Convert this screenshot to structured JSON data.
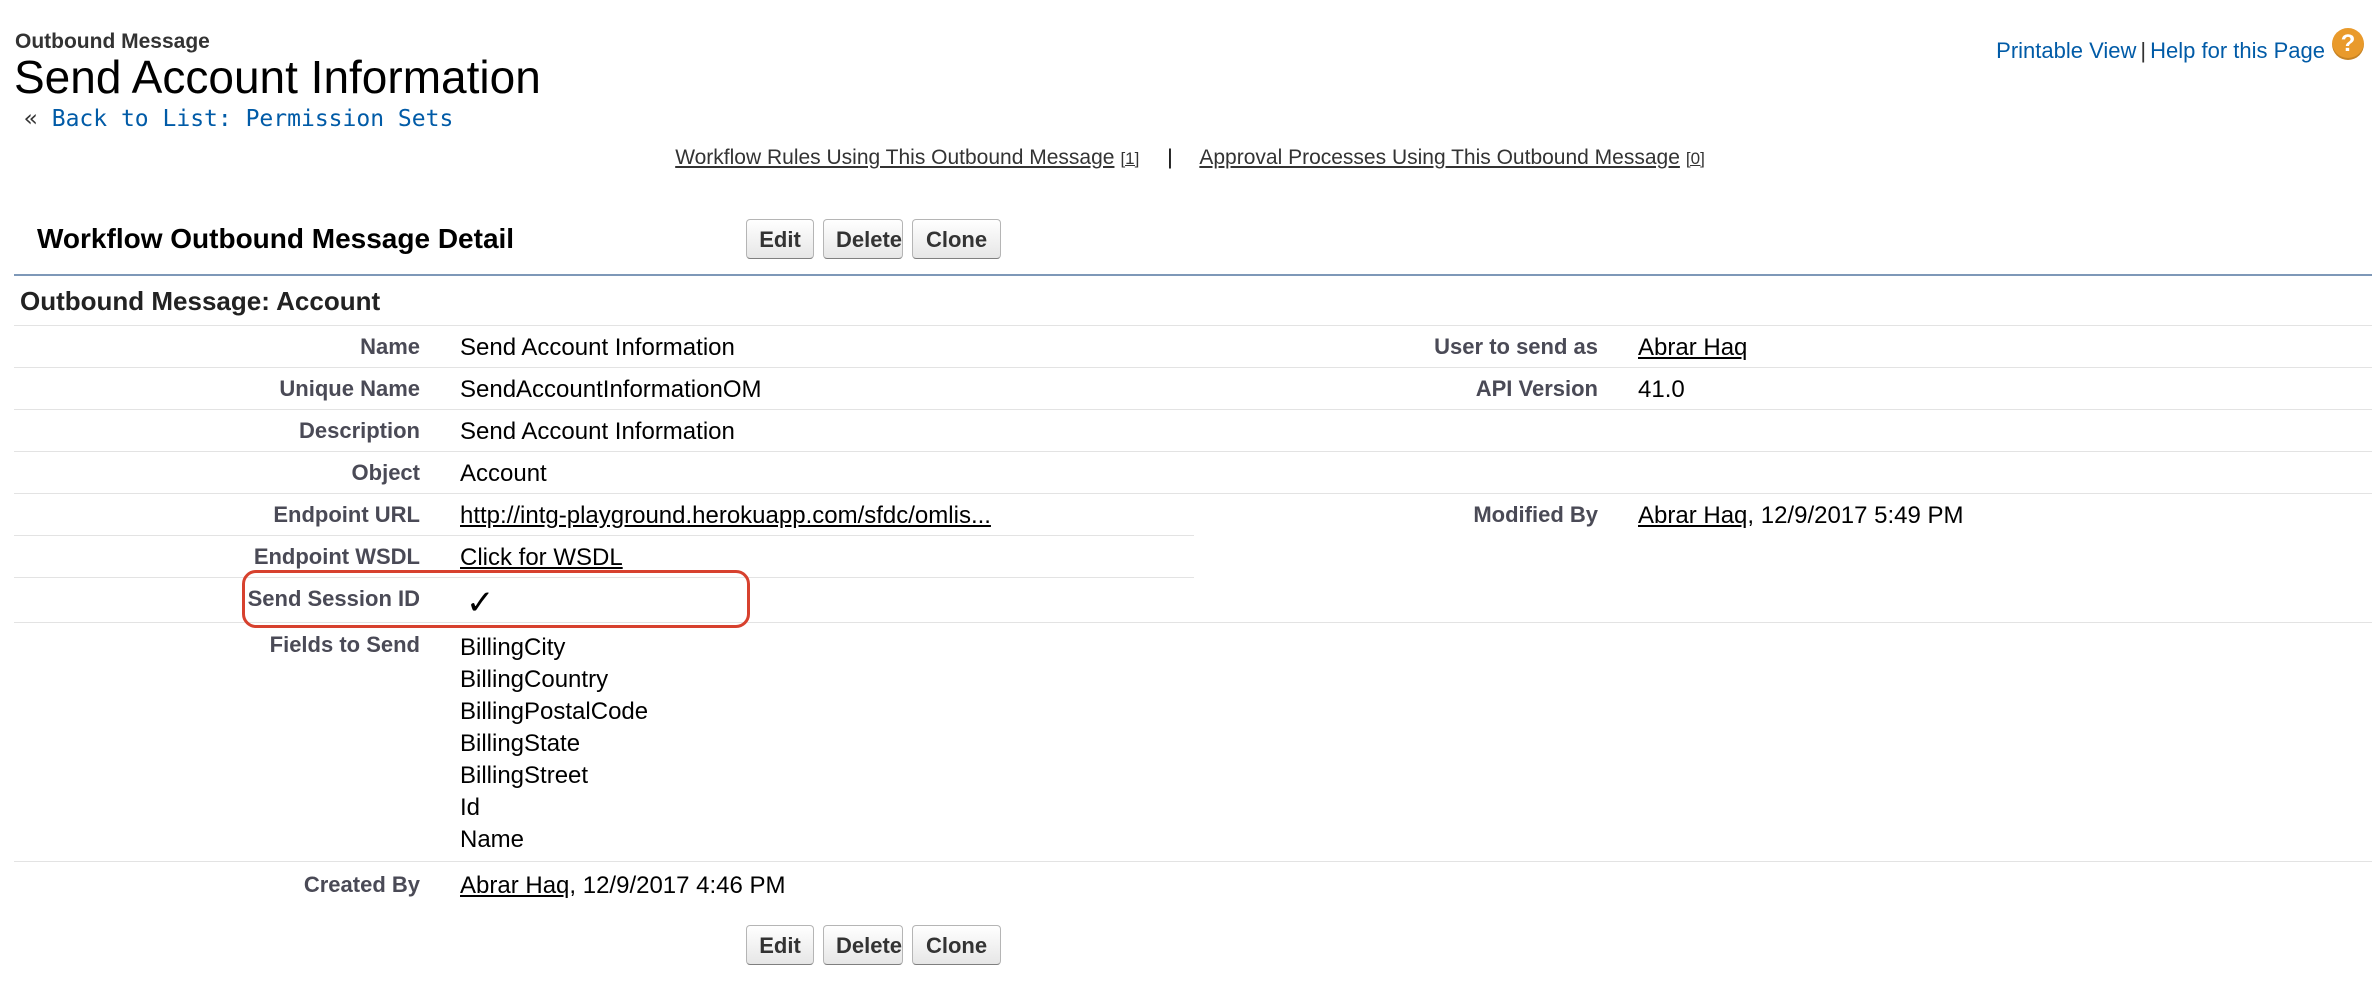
{
  "header": {
    "type_label": "Outbound Message",
    "title": "Send Account Information",
    "back_prefix": "«",
    "back_link": "Back to List: Permission Sets",
    "printable_view": "Printable View",
    "separator": "|",
    "help_link": "Help for this Page",
    "help_icon": "question-mark-icon",
    "help_icon_glyph": "?"
  },
  "related": {
    "workflow_rules_label": "Workflow Rules Using This Outbound Message",
    "workflow_rules_count": "[1]",
    "pipe": "|",
    "approval_label": "Approval Processes Using This Outbound Message",
    "approval_count": "[0]"
  },
  "detail": {
    "header": "Workflow Outbound Message Detail",
    "buttons": {
      "edit": "Edit",
      "delete": "Delete",
      "clone": "Clone"
    },
    "section_title": "Outbound Message: Account"
  },
  "fields": {
    "name": {
      "label": "Name",
      "value": "Send Account Information"
    },
    "unique_name": {
      "label": "Unique Name",
      "value": "SendAccountInformationOM"
    },
    "description": {
      "label": "Description",
      "value": "Send Account Information"
    },
    "object": {
      "label": "Object",
      "value": "Account"
    },
    "endpoint_url": {
      "label": "Endpoint URL",
      "value": "http://intg-playground.herokuapp.com/sfdc/omlis..."
    },
    "endpoint_wsdl": {
      "label": "Endpoint WSDL",
      "value": "Click for WSDL"
    },
    "send_session_id": {
      "label": "Send Session ID",
      "checked": true,
      "glyph": "✓"
    },
    "fields_to_send": {
      "label": "Fields to Send",
      "values": [
        "BillingCity",
        "BillingCountry",
        "BillingPostalCode",
        "BillingState",
        "BillingStreet",
        "Id",
        "Name"
      ]
    },
    "created_by": {
      "label": "Created By",
      "user": "Abrar Haq",
      "date": ", 12/9/2017 4:46 PM"
    },
    "user_to_send_as": {
      "label": "User to send as",
      "value": "Abrar Haq"
    },
    "api_version": {
      "label": "API Version",
      "value": "41.0"
    },
    "modified_by": {
      "label": "Modified By",
      "user": "Abrar Haq",
      "date": ", 12/9/2017 5:49 PM"
    }
  },
  "colors": {
    "link": "#015ba7",
    "rule": "#7e98b8",
    "highlight": "#d7412e",
    "help_icon": "#e99a2b"
  }
}
